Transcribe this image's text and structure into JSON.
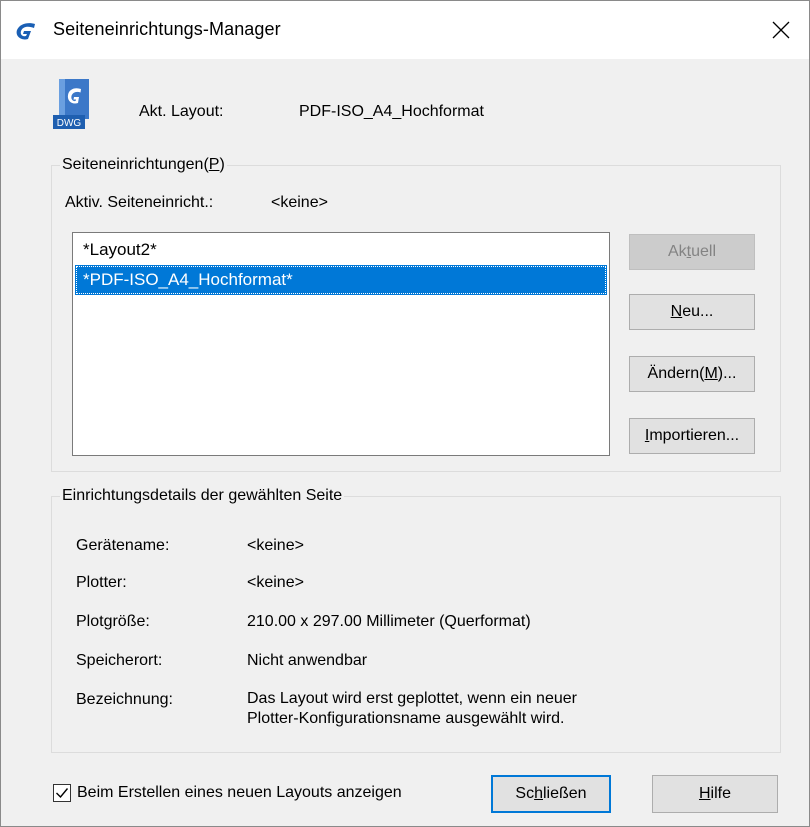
{
  "window": {
    "title": "Seiteneinrichtungs-Manager"
  },
  "header": {
    "icon_label": "DWG",
    "current_layout_label": "Akt. Layout:",
    "current_layout_value": "PDF-ISO_A4_Hochformat"
  },
  "setups": {
    "legend_text": "Seiteneinrichtungen(",
    "legend_key": "P",
    "legend_end": ")",
    "active_label": "Aktiv. Seiteneinricht.:",
    "active_value": "<keine>",
    "items": [
      {
        "label": "*Layout2*",
        "selected": false
      },
      {
        "label": "*PDF-ISO_A4_Hochformat*",
        "selected": true
      }
    ],
    "buttons": {
      "aktuell_pre": "Ak",
      "aktuell_key": "t",
      "aktuell_post": "uell",
      "neu_key": "N",
      "neu_post": "eu...",
      "aendern_pre": "Ändern(",
      "aendern_key": "M",
      "aendern_post": ")...",
      "importieren_key": "I",
      "importieren_post": "mportieren..."
    }
  },
  "details": {
    "legend": "Einrichtungsdetails der gewählten Seite",
    "rows": [
      {
        "label": "Gerätename:",
        "value": "<keine>"
      },
      {
        "label": "Plotter:",
        "value": "<keine>"
      },
      {
        "label": "Plotgröße:",
        "value": "210.00 x 297.00 Millimeter (Querformat)"
      },
      {
        "label": "Speicherort:",
        "value": "Nicht anwendbar"
      },
      {
        "label": "Bezeichnung:",
        "value_line1": "Das Layout wird erst geplottet, wenn ein neuer",
        "value_line2": "Plotter-Konfigurationsname ausgewählt wird."
      }
    ]
  },
  "footer": {
    "checkbox_label": "Beim Erstellen eines neuen Layouts anzeigen",
    "checkbox_checked": true,
    "close_pre": "Sc",
    "close_key": "h",
    "close_post": "ließen",
    "help_key": "H",
    "help_post": "ilfe"
  },
  "colors": {
    "accent": "#0078d7",
    "dialog_bg": "#f0f0f0"
  }
}
